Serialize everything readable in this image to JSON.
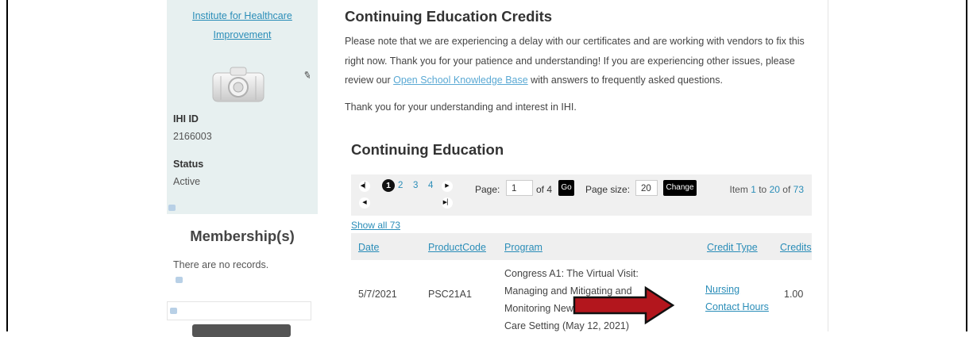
{
  "sidebar": {
    "org_link_line1": "Institute for Healthcare",
    "org_link_line2": "Improvement",
    "ihi_id_label": "IHI ID",
    "ihi_id_value": "2166003",
    "status_label": "Status",
    "status_value": "Active",
    "membership_title": "Membership(s)",
    "membership_empty": "There are no records."
  },
  "main": {
    "page_title": "Continuing Education Credits",
    "notice_part1": "Please note that we are experiencing a delay with our certificates and are working with vendors to fix this right now. Thank you for your patience and understanding! If you are experiencing other issues, please review our ",
    "notice_link": "Open School Knowledge Base",
    "notice_part2": " with answers to frequently asked questions.",
    "thanks": "Thank you for your understanding and interest in IHI.",
    "section_title": "Continuing Education"
  },
  "pager": {
    "first_icon": "first-page-icon",
    "prev_icon": "prev-page-icon",
    "next_icon": "next-page-icon",
    "last_icon": "last-page-icon",
    "current_page": "1",
    "pages": [
      "2",
      "3",
      "4"
    ],
    "page_label": "Page:",
    "page_input": "1",
    "of_text": "of 4",
    "go_label": "Go",
    "page_size_label": "Page size:",
    "page_size_value": "20",
    "change_label": "Change",
    "items_prefix": "Item",
    "items_from": "1",
    "items_to_word": "to",
    "items_to": "20",
    "items_of_word": "of",
    "items_total": "73"
  },
  "grid": {
    "show_all": "Show all 73",
    "columns": [
      "Date",
      "ProductCode",
      "Program",
      "Credit Type",
      "Credits"
    ],
    "rows": [
      {
        "date": "5/7/2021",
        "product_code": "PSC21A1",
        "program_lines": [
          "Congress A1: The Virtual Visit:",
          "Managing and Mitigating and",
          "Monitoring New Risks in a New",
          "Care Setting (May 12, 2021)"
        ],
        "credit_type_line1": "Nursing",
        "credit_type_line2": "Contact Hours",
        "credits": "1.00"
      }
    ]
  },
  "colors": {
    "link": "#2a8db8",
    "sidebar_bg": "#e7f0f0",
    "arrow": "#b3161d"
  }
}
